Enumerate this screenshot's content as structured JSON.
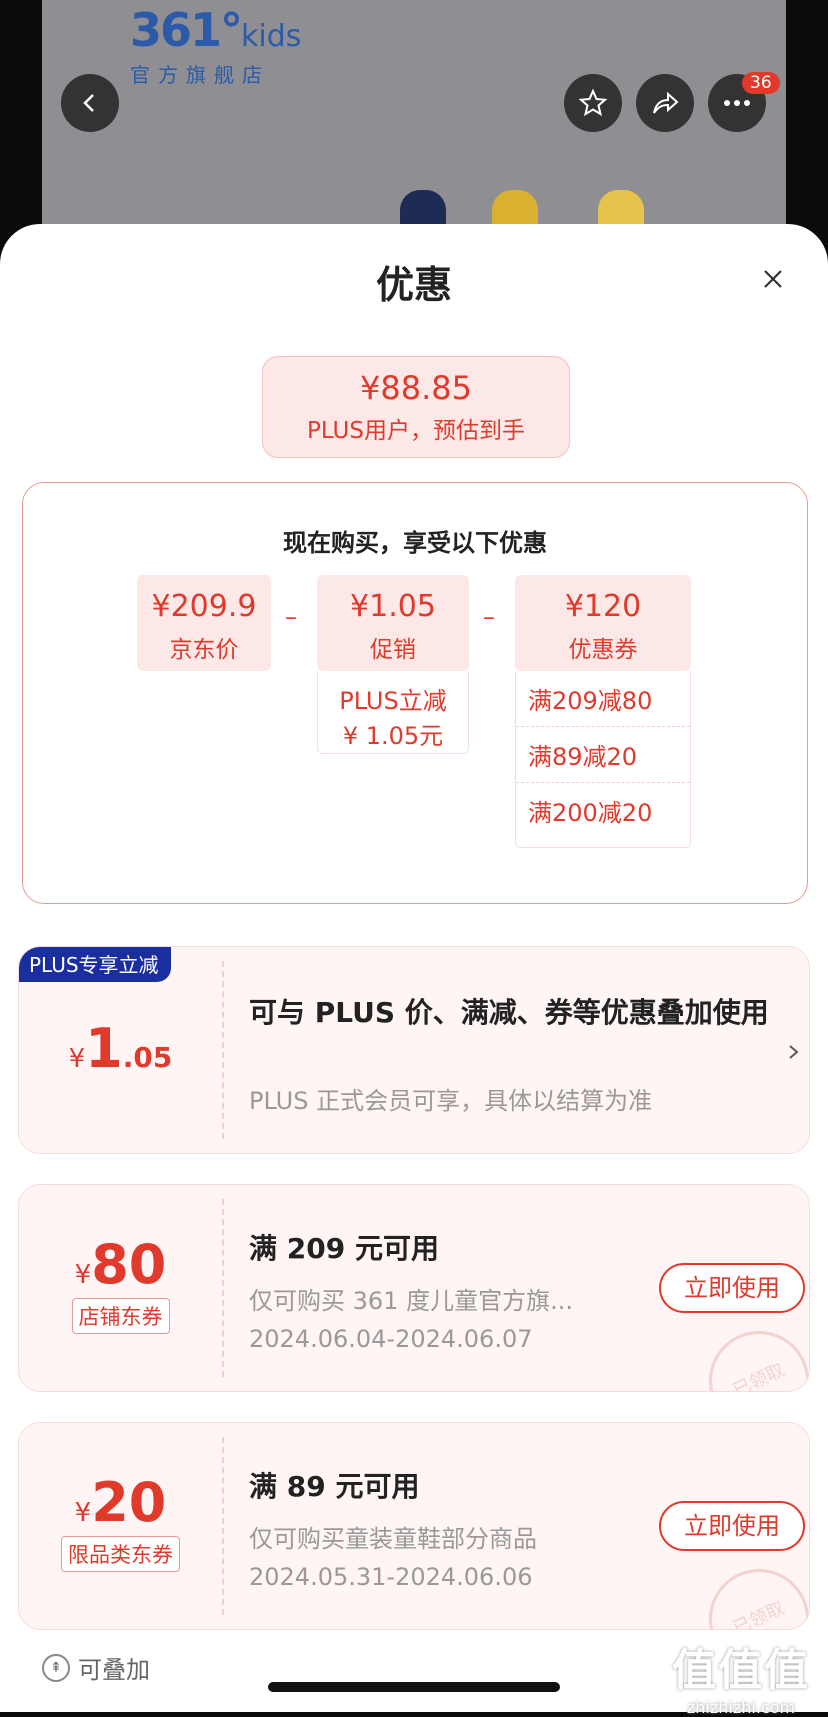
{
  "store": {
    "logo_main": "361°",
    "logo_kids": "kids",
    "logo_sub": "官方旗舰店"
  },
  "topbar": {
    "badge_count": "36"
  },
  "sheet": {
    "title": "优惠"
  },
  "estimate": {
    "price": "¥88.85",
    "label": "PLUS用户，预估到手"
  },
  "breakdown": {
    "heading": "现在购买，享受以下优惠",
    "jd_price": {
      "value": "¥209.9",
      "label": "京东价"
    },
    "promo": {
      "value": "¥1.05",
      "label": "促销",
      "detail_line1": "PLUS立减",
      "detail_line2": "¥ 1.05元"
    },
    "coupon": {
      "value": "¥120",
      "label": "优惠券",
      "items": [
        "满209减80",
        "满89减20",
        "满200减20"
      ]
    },
    "minus": "–"
  },
  "cards": [
    {
      "tag": "PLUS专享立减",
      "currency": "¥",
      "amount_int": "1",
      "amount_dec": ".05",
      "title": "可与 PLUS 价、满减、券等优惠叠加使用",
      "subtitle": "PLUS 正式会员可享，具体以结算为准"
    },
    {
      "currency": "¥",
      "amount": "80",
      "type": "店铺东券",
      "title": "满 209 元可用",
      "desc": "仅可购买 361 度儿童官方旗...",
      "dates": "2024.06.04-2024.06.07",
      "button": "立即使用",
      "stamp": "已领取"
    },
    {
      "currency": "¥",
      "amount": "20",
      "type": "限品类东券",
      "title": "满 89 元可用",
      "desc": "仅可购买童装童鞋部分商品",
      "dates": "2024.05.31-2024.06.06",
      "button": "立即使用",
      "stamp": "已领取"
    }
  ],
  "footer": {
    "stackable": "可叠加"
  },
  "watermark": {
    "big": "值值值",
    "small": "zhizhizhi.com"
  },
  "colors": {
    "accent": "#e03a2c",
    "plus_tag": "#1a2ea0",
    "card_bg": "#fff5f4"
  }
}
